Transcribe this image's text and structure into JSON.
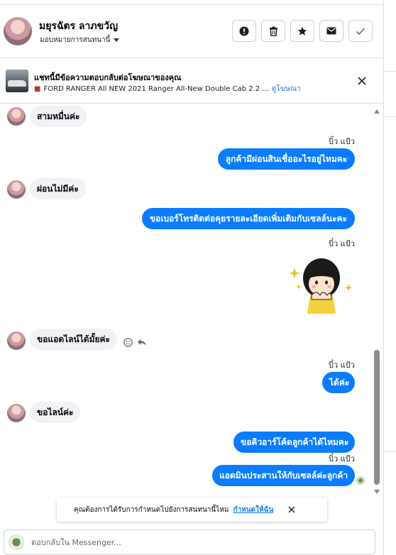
{
  "header": {
    "contact_name": "มยุรฉัตร ลาภขวัญ",
    "assign_label": "มอบหมายการสนทนานี้",
    "actions": [
      {
        "name": "report-icon"
      },
      {
        "name": "trash-icon"
      },
      {
        "name": "star-icon"
      },
      {
        "name": "mail-icon"
      },
      {
        "name": "check-icon"
      }
    ]
  },
  "ad_banner": {
    "title": "แชทนี้มีข้อความตอบกลับต่อโฆษณาของคุณ",
    "ad_text": "FORD RANGER All NEW 2021 Ranger All-New Double Cab 2.2 ...",
    "ad_link": "ดูโฆษณา"
  },
  "messages": [
    {
      "dir": "in",
      "text": "สามหมื่นค่ะ"
    },
    {
      "dir": "out",
      "sender": "บิ๋ว แป้ว",
      "text": "ลูกค้ามีผ่อนสินเชื่ออะไรอยู่ไหมคะ"
    },
    {
      "dir": "in",
      "text": "ผ่อนไม่มีค่ะ"
    },
    {
      "dir": "out",
      "text": "ขอเบอร์โทรติดต่อคุยรายละเอียดเพิ่มเติมกับเซลล์นะคะ"
    },
    {
      "dir": "out",
      "sender": "บิ๋ว แป้ว",
      "sticker": "girl-sticker"
    },
    {
      "dir": "in",
      "text": "ขอแอดไลน์ได้มั้ยค่ะ"
    },
    {
      "dir": "out",
      "sender": "บิ๋ว แป้ว",
      "text": "ได้ค่ะ"
    },
    {
      "dir": "in",
      "text": "ขอไลน์ค่ะ"
    },
    {
      "dir": "out",
      "text": "ขอคิวอาร์โค้ดลูกค้าได้ไหมคะ"
    },
    {
      "dir": "out",
      "sender": "บิ๋ว แป้ว",
      "text": "แอดมินประสานให้กับเซลล์ค่ะลูกค้า"
    }
  ],
  "notice": {
    "text": "คุณต้องการได้รับการกำหนดไปยังการสนทนานี้ไหม",
    "link": "กำหนดให้ฉัน"
  },
  "composer": {
    "placeholder": "ตอบกลับใน Messenger..."
  },
  "colors": {
    "outgoing_bubble": "#0a7cff",
    "incoming_bubble": "#f0f2f5",
    "link": "#1877f2"
  }
}
